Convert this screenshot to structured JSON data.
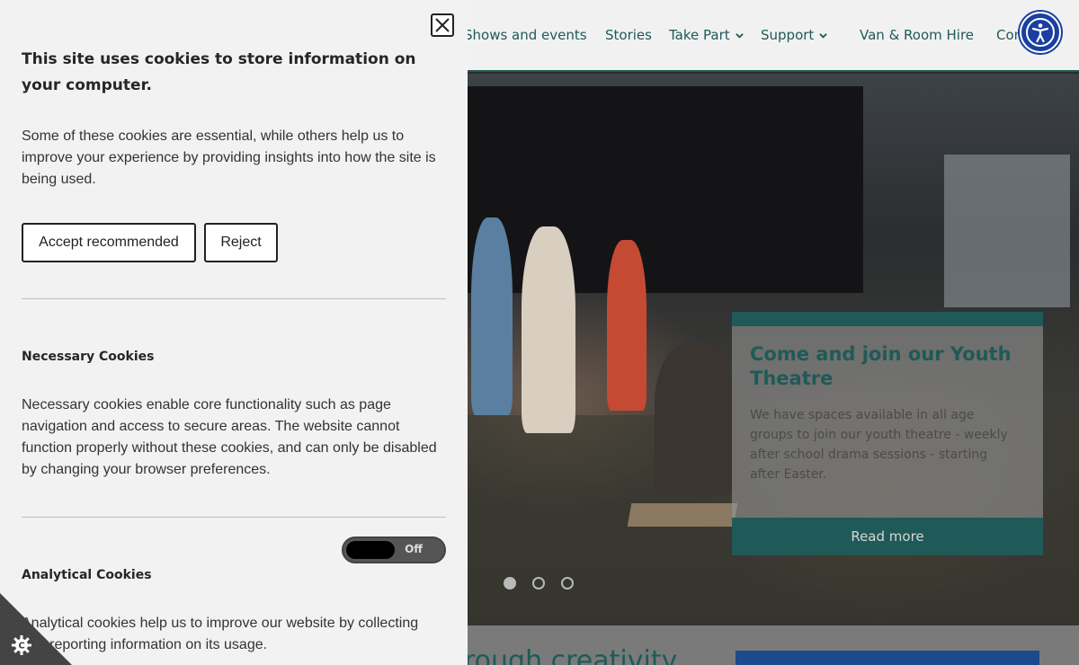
{
  "site": {
    "nav": [
      {
        "label": "Shows and events",
        "dropdown": false
      },
      {
        "label": "Stories",
        "dropdown": false
      },
      {
        "label": "Take Part",
        "dropdown": true
      },
      {
        "label": "Support",
        "dropdown": true
      },
      {
        "label": "Van & Room Hire",
        "dropdown": false
      },
      {
        "label": "Con",
        "dropdown": false
      }
    ],
    "accessibility_icon": "accessibility-icon",
    "hero_card": {
      "title": "Come and join our Youth Theatre",
      "text": "We have spaces available in all age groups to join our youth theatre - weekly after school drama sessions - starting after Easter.",
      "button": "Read more"
    },
    "carousel": {
      "slides": 3,
      "active": 1
    },
    "below_heading": "rough creativity"
  },
  "cookie_panel": {
    "title": "This site uses cookies to store information on your computer.",
    "intro": "Some of these cookies are essential, while others help us to improve your experience by providing insights into how the site is being used.",
    "accept_label": "Accept recommended",
    "reject_label": "Reject",
    "necessary": {
      "title": "Necessary Cookies",
      "text": "Necessary cookies enable core functionality such as page navigation and access to secure areas. The website cannot function properly without these cookies, and can only be disabled by changing your browser preferences."
    },
    "analytical": {
      "title": "Analytical Cookies",
      "toggle_label": "Off",
      "text": "Analytical cookies help us to improve our website by collecting and reporting information on its usage."
    },
    "close_icon": "close-icon",
    "settings_icon": "cookie-settings-icon"
  },
  "colors": {
    "teal": "#1f5a58",
    "panel_bg": "#f2f2f2",
    "accessibility_blue": "#1a3fa0"
  }
}
